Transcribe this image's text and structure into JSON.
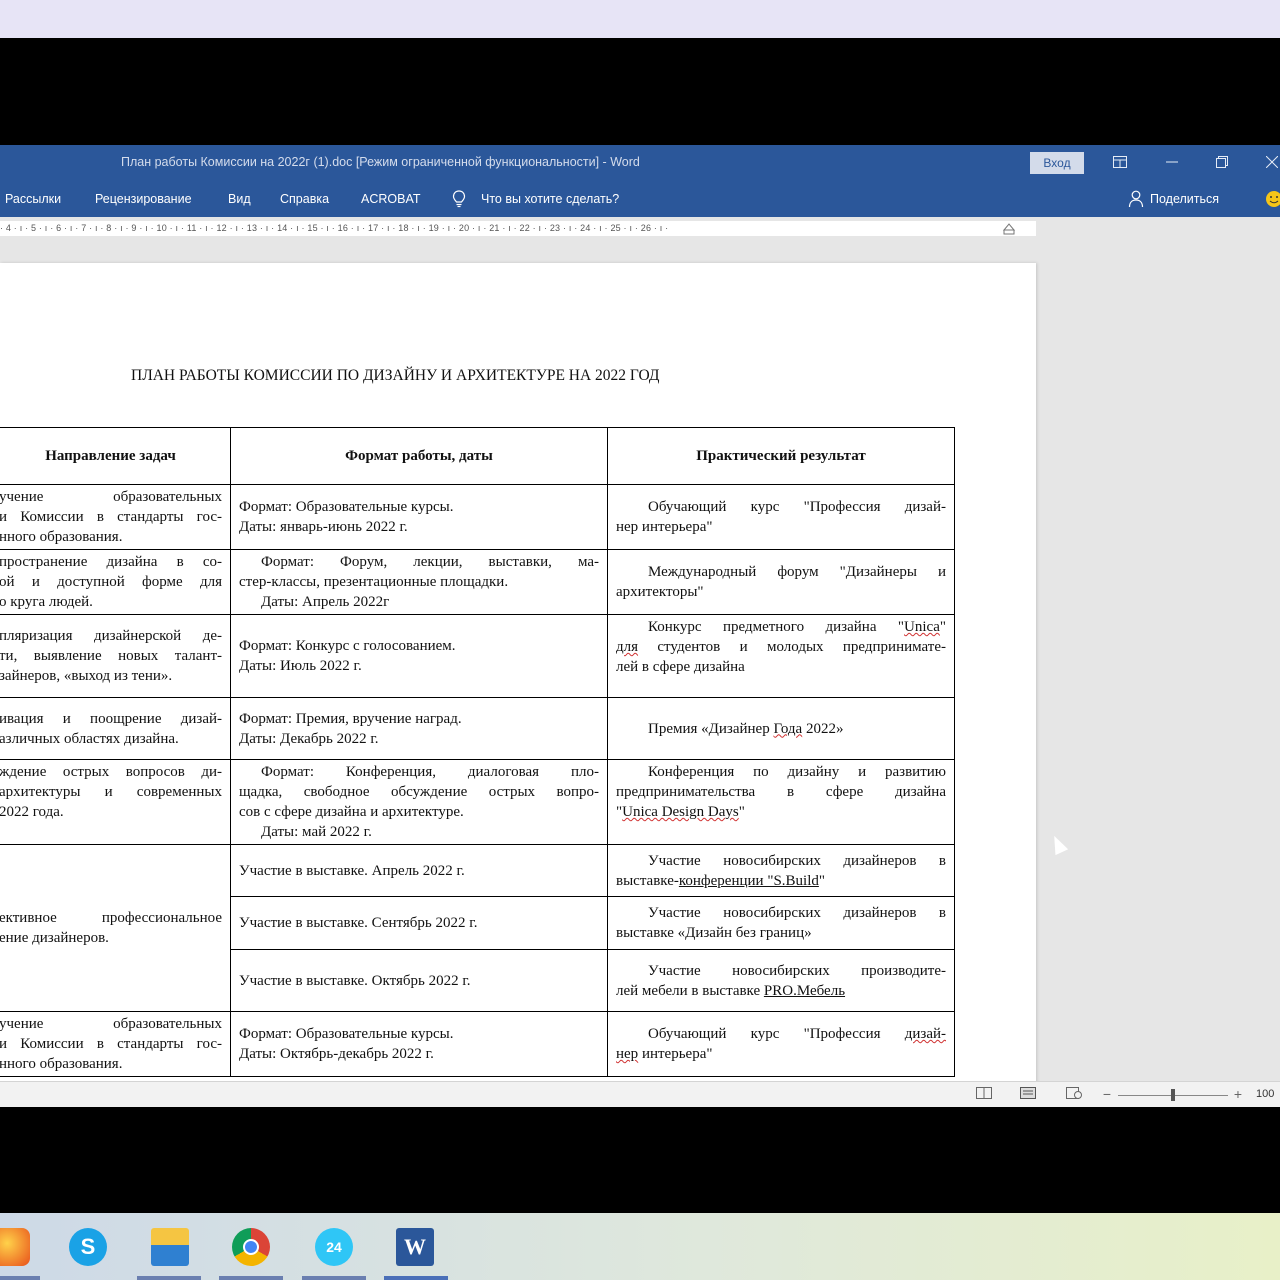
{
  "window": {
    "title": "План работы Комиссии на 2022г (1).doc [Режим ограниченной функциональности]  -  Word",
    "signin_label": "Вход",
    "ribbon_display_icon": "ribbon-display-icon",
    "minimize_icon": "minimize-icon",
    "restore_icon": "restore-icon",
    "close_icon": "close-icon"
  },
  "menubar": {
    "items": [
      "Рассылки",
      "Рецензирование",
      "Вид",
      "Справка",
      "ACROBAT"
    ],
    "tell_me": "Что вы хотите сделать?",
    "share": "Поделиться"
  },
  "ruler": {
    "text": "· 4 · ı · 5 · ı · 6 · ı · 7 · ı · 8 · ı · 9 · ı · 10 · ı · 11 · ı · 12 · ı · 13 · ı · 14 · ı · 15 · ı · 16 · ı · 17 · ı · 18 · ı · 19 · ı · 20 · ı · 21 · ı · 22 · ı · 23 · ı · 24 · ı · 25 · ı · 26 · ı ·"
  },
  "document": {
    "title": "ПЛАН РАБОТЫ КОМИССИИ ПО ДИЗАЙНУ И АРХИТЕКТУРЕ НА 2022 ГОД",
    "headers": [
      "Направление задач",
      "Формат работы, даты",
      "Практический результат"
    ],
    "row1": {
      "c1": [
        "учение образовательных",
        "и Комиссии в стандарты гос-",
        "нного образования."
      ],
      "c2": [
        "Формат: Образовательные курсы.",
        "Даты: январь-июнь 2022 г."
      ],
      "c3": [
        "Обучающий курс \"Профессия дизай-",
        "нер интерьера\""
      ]
    },
    "row2": {
      "c1": [
        "пространение дизайна в со-",
        "ой и доступной форме для",
        "о круга людей."
      ],
      "c2": [
        "Формат: Форум, лекции, выставки, ма-",
        "стер-классы, презентационные площадки.",
        "Даты: Апрель 2022г"
      ],
      "c3": [
        "Международный форум \"Дизайнеры и",
        "архитекторы\""
      ]
    },
    "row3": {
      "c1": [
        "пляризация дизайнерской де-",
        "ти, выявление новых талант-",
        "зайнеров, «выход из тени»."
      ],
      "c2": [
        "Формат: Конкурс с голосованием.",
        "Даты: Июль 2022 г."
      ],
      "c3_a": "Конкурс предметного дизайна \"",
      "c3_unica": "Unica",
      "c3_b": "\"",
      "c3_dlya": "для",
      "c3_c": " студентов и молодых предпринимате-",
      "c3_d": "лей в сфере дизайна"
    },
    "row4": {
      "c1": [
        "ивация и поощрение дизай-",
        "азличных областях дизайна."
      ],
      "c2": [
        "Формат: Премия, вручение наград.",
        "Даты: Декабрь 2022 г."
      ],
      "c3_a": "Премия «Дизайнер ",
      "c3_goda": "Года",
      "c3_b": " 2022»"
    },
    "row5": {
      "c1": [
        "ждение острых вопросов ди-",
        "архитектуры и современных",
        "2022 года."
      ],
      "c2": [
        "Формат: Конференция, диалоговая пло-",
        "щадка, свободное обсуждение острых вопро-",
        "сов с сфере дизайна и архитектуре.",
        "Даты: май 2022 г."
      ],
      "c3_a": "Конференция по дизайну и развитию",
      "c3_b": "предпринимательства в сфере дизайна",
      "c3_c": "\"",
      "c3_unica": "Unica Design Days",
      "c3_d": "\""
    },
    "row6": {
      "c1": [
        "ективное профессиональное",
        "ение дизайнеров."
      ],
      "sub1_c2": "Участие в выставке. Апрель 2022 г.",
      "sub1_c3_a": "Участие новосибирских дизайнеров в",
      "sub1_c3_b": "выставке-",
      "sub1_c3_conf": "конференции  \"S.Build",
      "sub1_c3_c": "\"",
      "sub2_c2": "Участие в выставке. Сентябрь 2022 г.",
      "sub2_c3": [
        "Участие новосибирских дизайнеров в",
        "выставке «Дизайн без границ»"
      ],
      "sub3_c2": "Участие в выставке. Октябрь 2022 г.",
      "sub3_c3_a": "Участие новосибирских производите-",
      "sub3_c3_b": "лей мебели в выставке ",
      "sub3_c3_pro": "PRO.Мебель"
    },
    "row7": {
      "c1": [
        "учение образовательных",
        "и Комиссии в стандарты гос-",
        "нного образования."
      ],
      "c2": [
        "Формат: Образовательные курсы.",
        "Даты: Октябрь-декабрь 2022 г."
      ],
      "c3_a": "Обучающий курс \"Профессия ",
      "c3_diz": "дизай-",
      "c3_ner": "нер",
      "c3_b": " интерьера\""
    }
  },
  "statusbar": {
    "zoom": "100"
  },
  "taskbar": {
    "apps": [
      "browser-icon",
      "skype-icon",
      "file-explorer-icon",
      "chrome-icon",
      "bitrix24-icon",
      "word-icon"
    ],
    "skype_letter": "S",
    "bitrix_label": "24",
    "word_letter": "W"
  }
}
